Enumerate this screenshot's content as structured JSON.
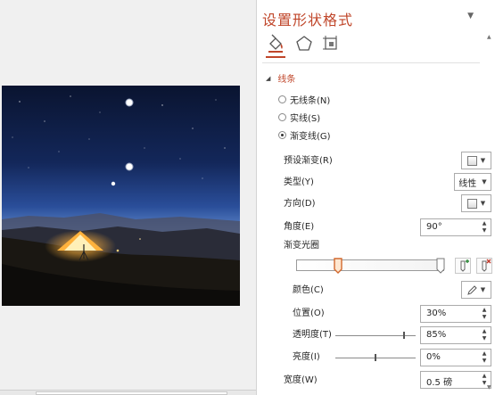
{
  "panel": {
    "title": "设置形状格式",
    "tabs": [
      {
        "name": "fill-line",
        "icon": "paint-bucket-icon"
      },
      {
        "name": "effects",
        "icon": "pentagon-icon"
      },
      {
        "name": "size-properties",
        "icon": "size-properties-icon"
      }
    ]
  },
  "section": {
    "title": "线条"
  },
  "line_options": [
    {
      "label": "无线条(N)",
      "selected": false
    },
    {
      "label": "实线(S)",
      "selected": false
    },
    {
      "label": "渐变线(G)",
      "selected": true
    }
  ],
  "fields": {
    "preset": {
      "label": "预设渐变(R)"
    },
    "type": {
      "label": "类型(Y)",
      "value": "线性"
    },
    "direction": {
      "label": "方向(D)"
    },
    "angle": {
      "label": "角度(E)",
      "value": "90°"
    },
    "gradient_stops": {
      "label": "渐变光圈"
    },
    "color": {
      "label": "颜色(C)"
    },
    "position": {
      "label": "位置(O)",
      "value": "30%"
    },
    "transparency": {
      "label": "透明度(T)",
      "value": "85%",
      "level": 0.85
    },
    "brightness": {
      "label": "亮度(I)",
      "value": "0%",
      "level": 0.5
    },
    "width": {
      "label": "宽度(W)",
      "value": "0.5 磅"
    }
  },
  "colors": {
    "accent": "#c0462a",
    "sky_top": "#0a1533",
    "sky_horizon": "#e6a35c",
    "tent_glow": "#ffb23c"
  }
}
